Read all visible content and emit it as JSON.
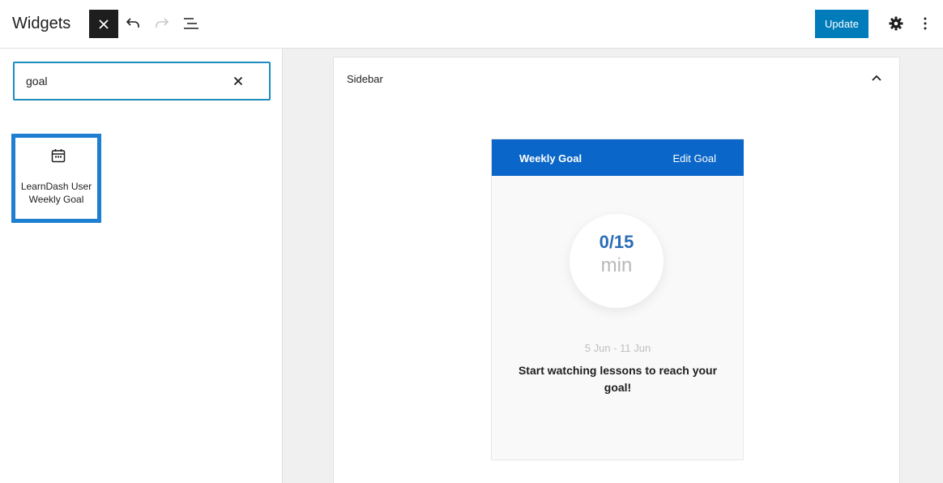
{
  "header": {
    "title": "Widgets",
    "update_label": "Update",
    "icons": [
      "close-icon",
      "undo-icon",
      "redo-icon",
      "list-view-icon",
      "gear-icon",
      "more-vertical-icon"
    ]
  },
  "inserter": {
    "search_value": "goal",
    "results": [
      {
        "label_line1": "LearnDash User",
        "label_line2": "Weekly Goal",
        "icon": "calendar-icon"
      }
    ]
  },
  "area": {
    "label": "Sidebar"
  },
  "widget": {
    "title": "Weekly Goal",
    "edit_label": "Edit Goal",
    "value": "0/15",
    "unit": "min",
    "dates": "5 Jun - 11 Jun",
    "message": "Start watching lessons to reach your goal!"
  },
  "colors": {
    "accent": "#007cba",
    "widget_header": "#0a66c8",
    "selection": "#1e7ed0"
  }
}
